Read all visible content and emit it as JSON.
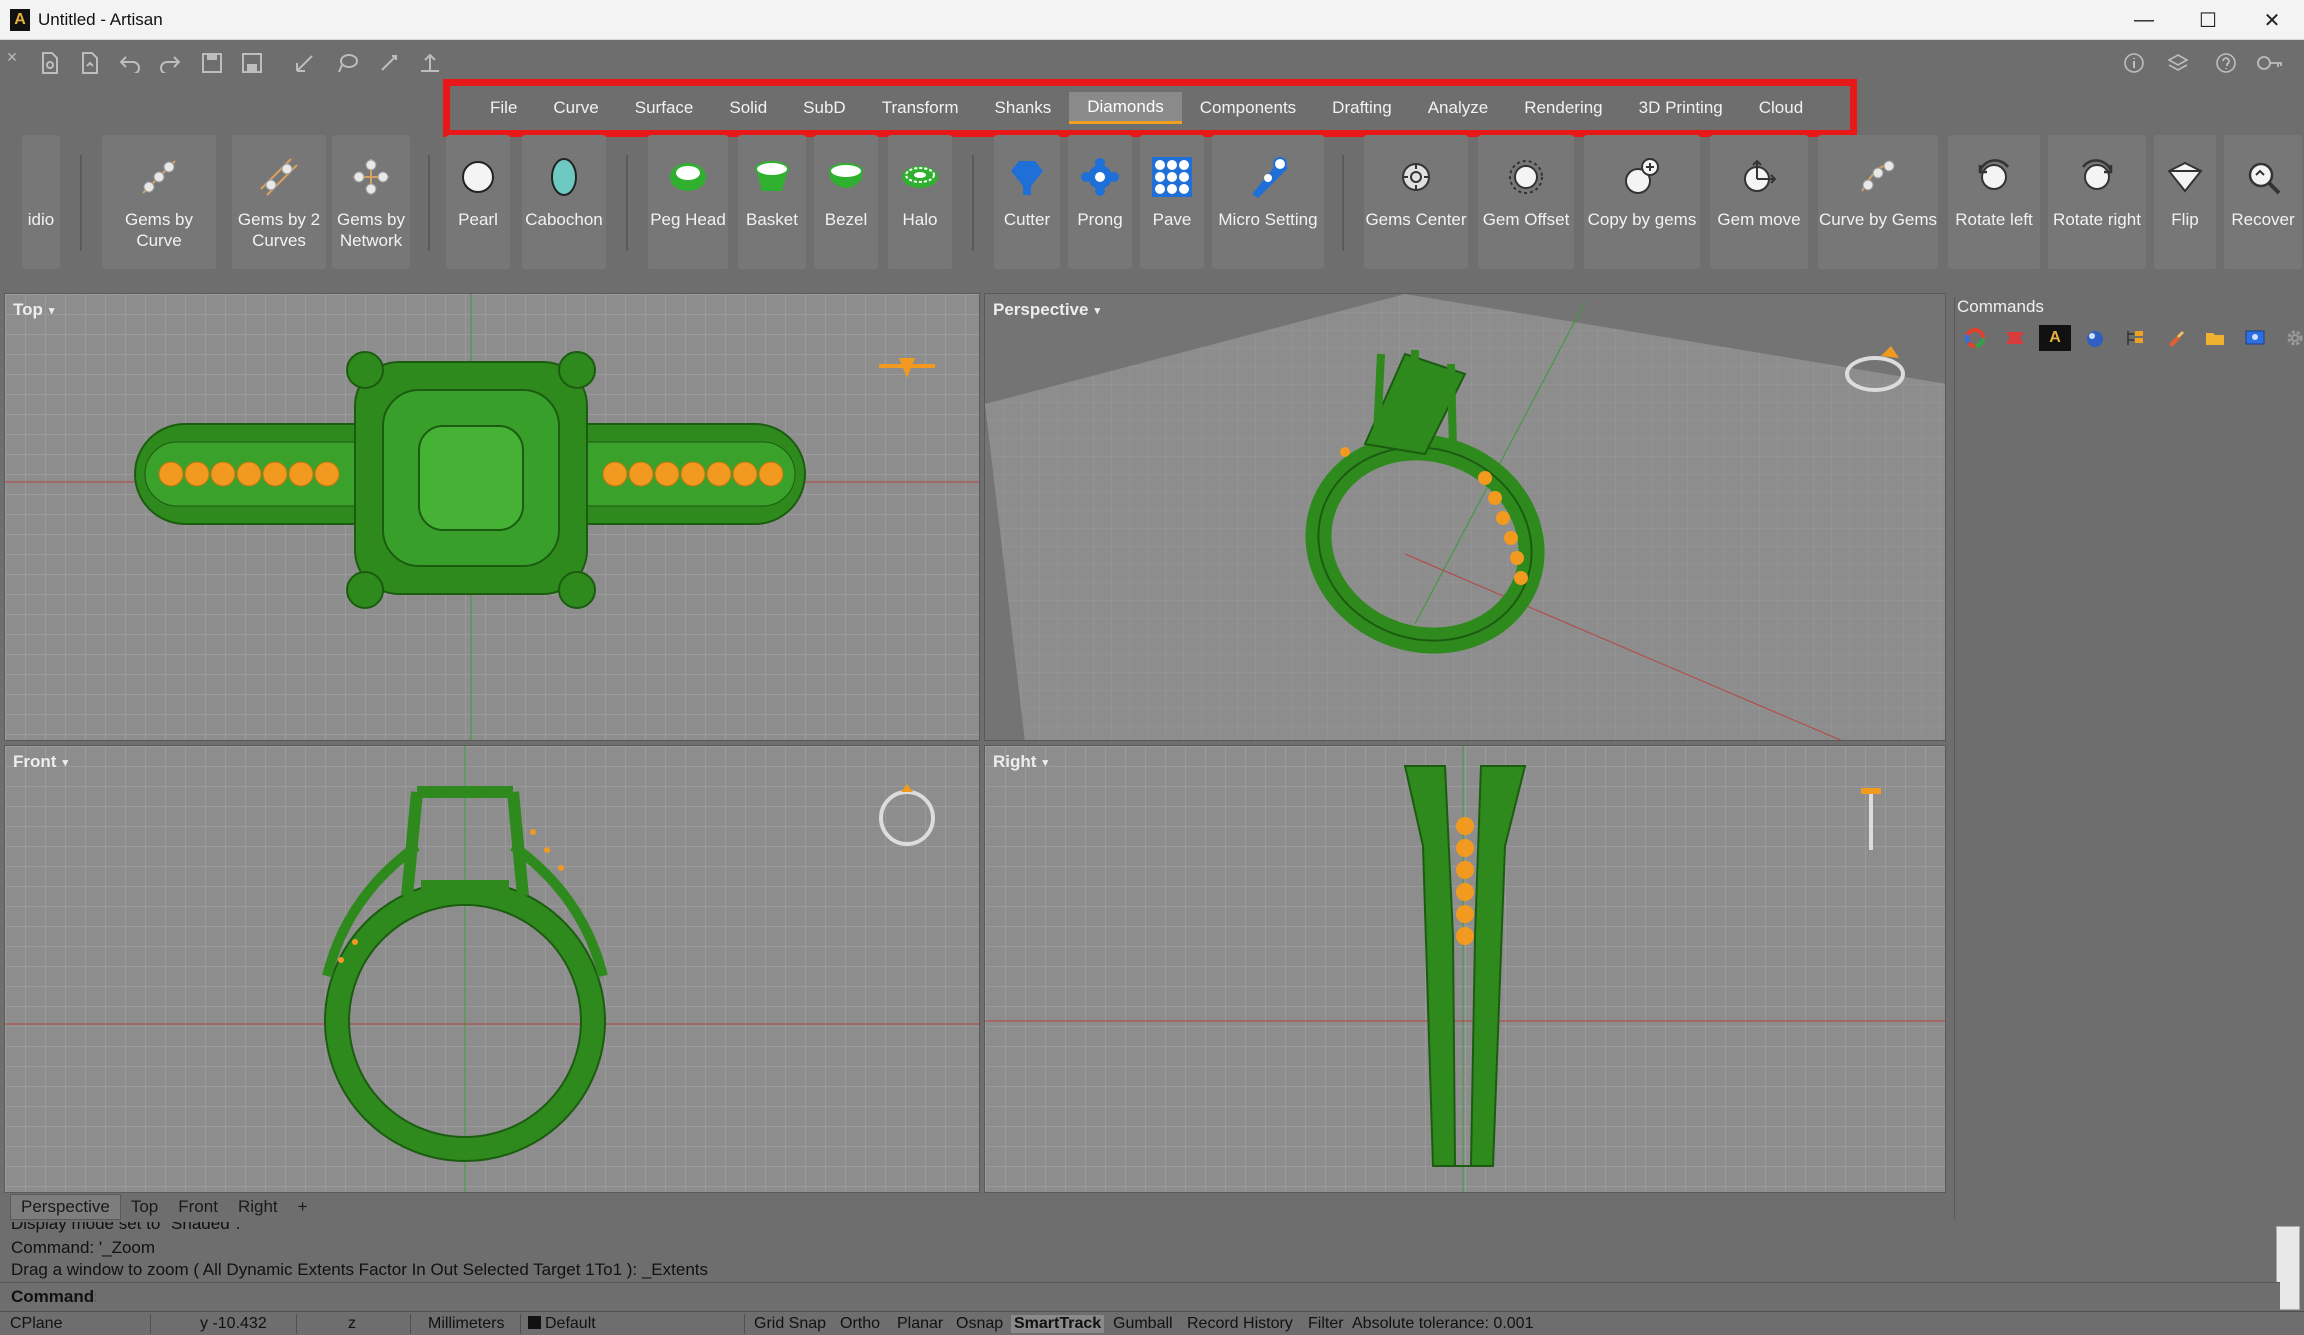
{
  "window": {
    "title": "Untitled - Artisan",
    "logo_text": "A",
    "minimize": "—",
    "maximize": "☐",
    "close": "✕"
  },
  "quickbar": {
    "icons": [
      "close-x-icon",
      "new-file-icon",
      "open-file-icon",
      "undo-icon",
      "redo-icon",
      "save-icon",
      "save-as-icon",
      "select-icon",
      "lasso-icon",
      "pointer-icon",
      "transform-icon"
    ],
    "right_icons": [
      "info-icon",
      "layers-icon",
      "help-icon",
      "key-icon"
    ]
  },
  "menu": {
    "tabs": [
      "File",
      "Curve",
      "Surface",
      "Solid",
      "SubD",
      "Transform",
      "Shanks",
      "Diamonds",
      "Components",
      "Drafting",
      "Analyze",
      "Rendering",
      "3D Printing",
      "Cloud"
    ],
    "active": "Diamonds"
  },
  "ribbon": {
    "buttons": [
      {
        "label": "idio"
      },
      {
        "label": "Gems by Curve"
      },
      {
        "label": "Gems by 2 Curves"
      },
      {
        "label": "Gems by Network"
      },
      {
        "label": "Pearl"
      },
      {
        "label": "Cabochon"
      },
      {
        "label": "Peg Head"
      },
      {
        "label": "Basket"
      },
      {
        "label": "Bezel"
      },
      {
        "label": "Halo"
      },
      {
        "label": "Cutter"
      },
      {
        "label": "Prong"
      },
      {
        "label": "Pave"
      },
      {
        "label": "Micro Setting"
      },
      {
        "label": "Gems Center"
      },
      {
        "label": "Gem Offset"
      },
      {
        "label": "Copy by gems"
      },
      {
        "label": "Gem move"
      },
      {
        "label": "Curve by Gems"
      },
      {
        "label": "Rotate left"
      },
      {
        "label": "Rotate right"
      },
      {
        "label": "Flip"
      },
      {
        "label": "Recover"
      }
    ]
  },
  "viewports": {
    "top": "Top",
    "perspective": "Perspective",
    "front": "Front",
    "right": "Right",
    "caret": "▾"
  },
  "panel": {
    "title": "Commands",
    "icons": [
      "color-wheel-icon",
      "ribbon-icon",
      "artisan-icon",
      "material-icon",
      "layers-tree-icon",
      "brush-icon",
      "folder-icon",
      "display-icon",
      "settings-gear-icon"
    ],
    "artisan_glyph": "A"
  },
  "view_tabs": [
    "Perspective",
    "Top",
    "Front",
    "Right",
    "+"
  ],
  "command_history": [
    "Display mode set to \"Shaded\".",
    "Command: '_Zoom",
    "Drag a window to zoom ( All  Dynamic  Extents  Factor  In  Out  Selected  Target  1To1 ): _Extents"
  ],
  "command_prompt": "Command:",
  "status": {
    "cplane": "CPlane",
    "y": "y -10.432",
    "z": "z",
    "units": "Millimeters",
    "layer": "Default",
    "grid_snap": "Grid Snap",
    "ortho": "Ortho",
    "planar": "Planar",
    "osnap": "Osnap",
    "smarttrack": "SmartTrack",
    "gumball": "Gumball",
    "record_history": "Record History",
    "filter": "Filter",
    "tolerance": "Absolute tolerance: 0.001"
  },
  "colors": {
    "model_green": "#2f8a1d",
    "gem_orange": "#f19a1f",
    "highlight_red": "#e81818"
  }
}
